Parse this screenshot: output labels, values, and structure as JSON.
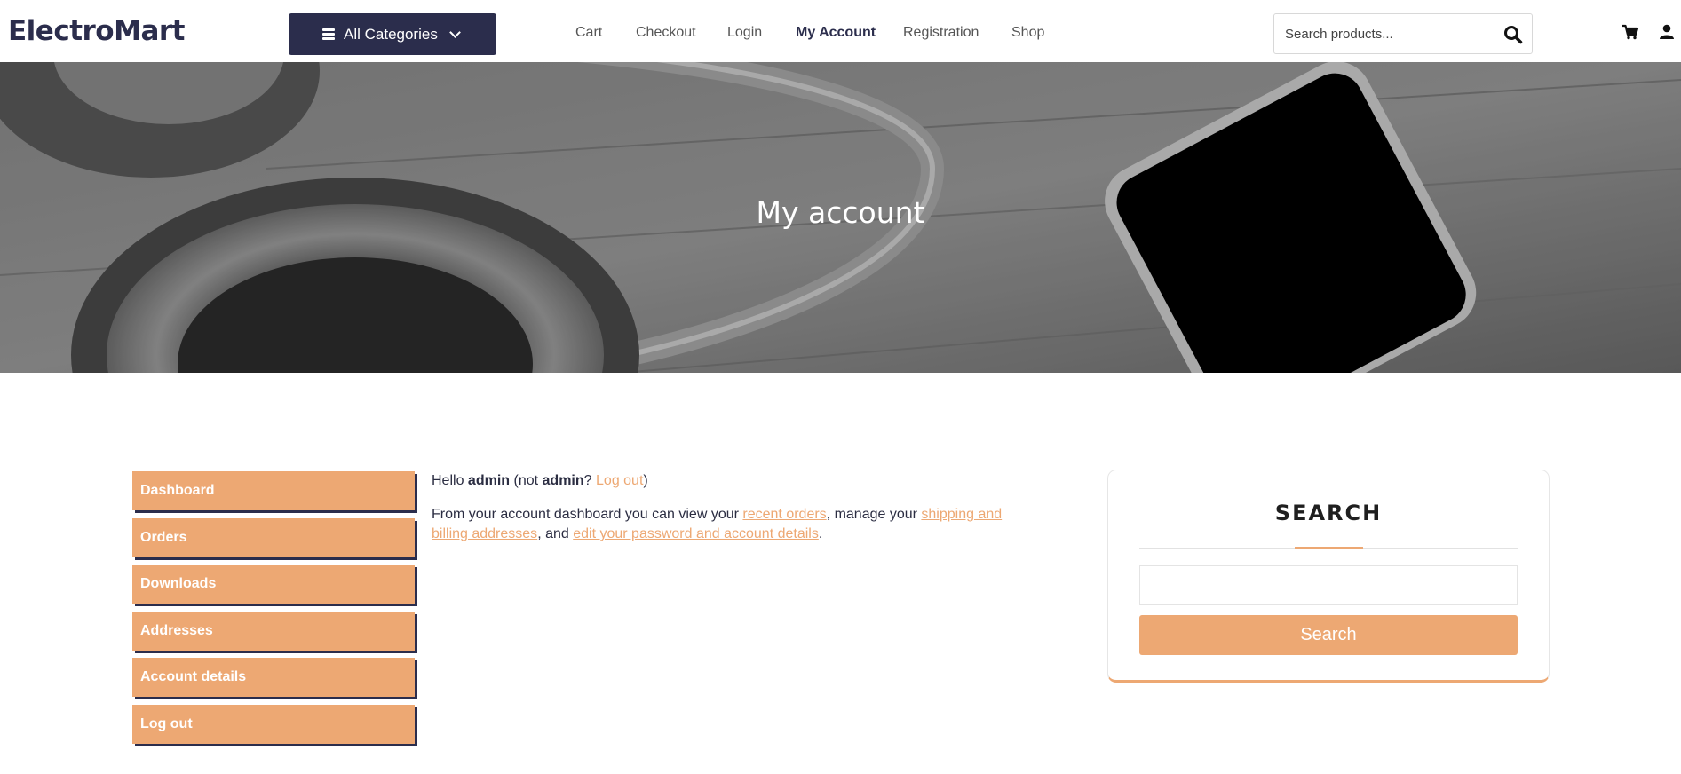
{
  "header": {
    "logo": "ElectroMart",
    "categories_label": "All Categories",
    "nav": [
      {
        "label": "Cart"
      },
      {
        "label": "Checkout"
      },
      {
        "label": "Login"
      },
      {
        "label": "My Account",
        "active": true
      },
      {
        "label": "Registration"
      },
      {
        "label": "Shop"
      }
    ],
    "search_placeholder": "Search products...",
    "icons": [
      "bars-icon",
      "chevron-down-icon",
      "search-icon",
      "cart-icon",
      "user-icon"
    ]
  },
  "hero": {
    "title": "My account"
  },
  "account_nav": [
    {
      "label": "Dashboard"
    },
    {
      "label": "Orders"
    },
    {
      "label": "Downloads"
    },
    {
      "label": "Addresses"
    },
    {
      "label": "Account details"
    },
    {
      "label": "Log out"
    }
  ],
  "content": {
    "hello": "Hello",
    "user": "admin",
    "not_open": "(not",
    "not_user": "admin",
    "question": "?",
    "logout_link": "Log out",
    "close_paren": ")",
    "intro": "From your account dashboard you can view your",
    "recent_orders_link": "recent orders",
    "manage": ", manage your",
    "addresses_link": "shipping and billing addresses",
    "and": ", and",
    "password_link": "edit your password and account details",
    "period": "."
  },
  "widget": {
    "title": "SEARCH",
    "button_label": "Search",
    "input_value": ""
  },
  "colors": {
    "brand_dark": "#2b2d4c",
    "accent": "#eda873",
    "text": "#2b2d42"
  }
}
